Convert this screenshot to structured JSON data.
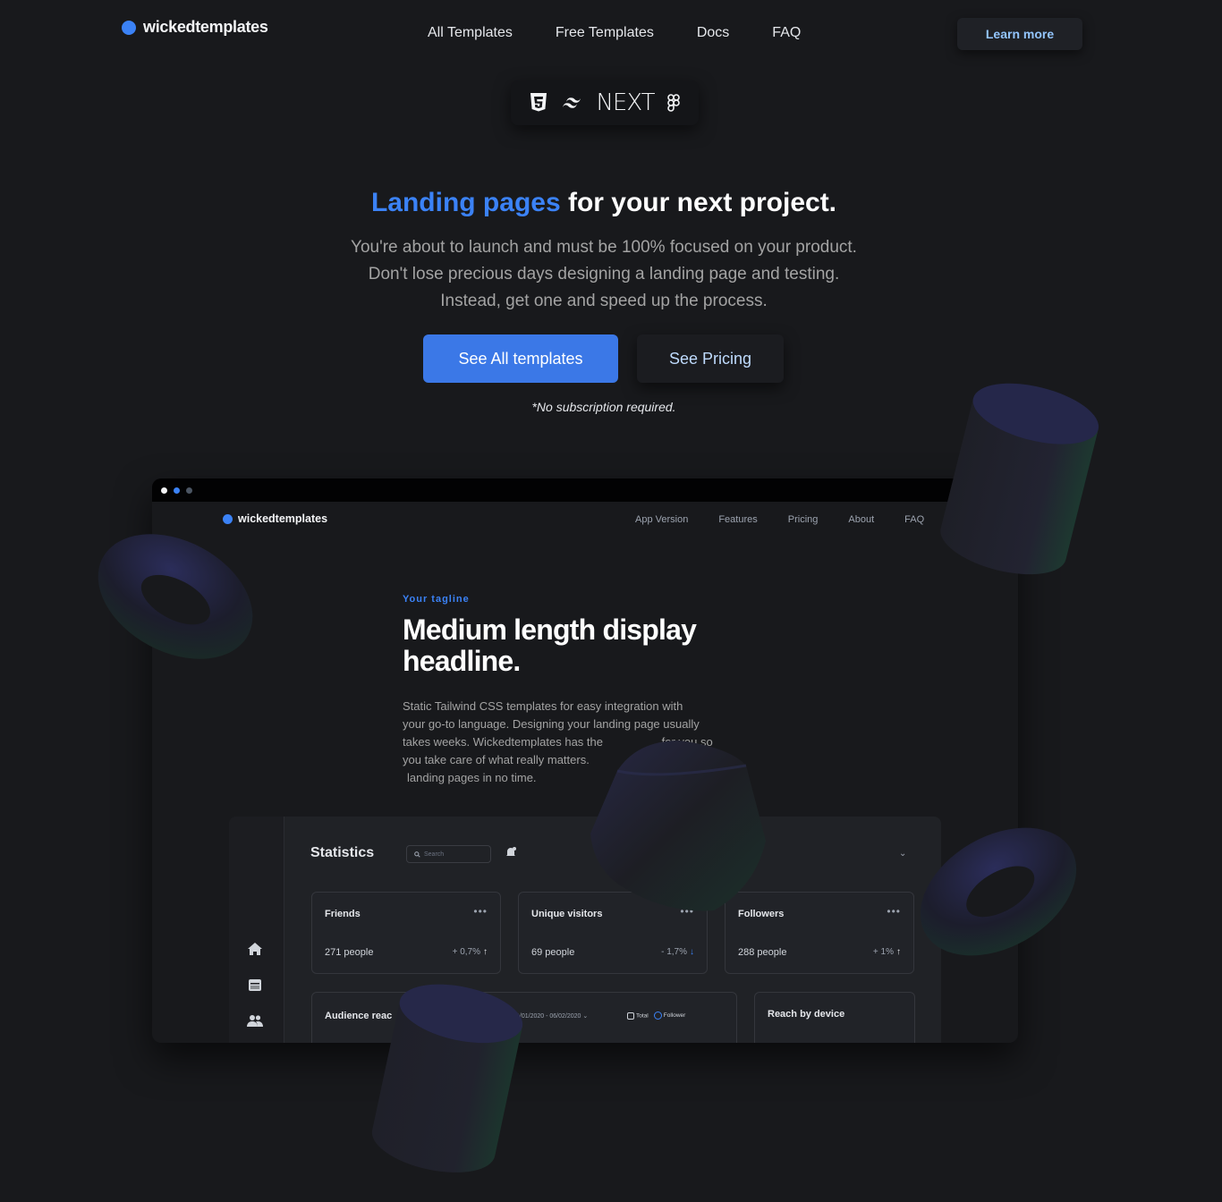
{
  "brand": {
    "name": "wickedtemplates",
    "accent": "#3b82f6"
  },
  "nav": {
    "links": [
      "All Templates",
      "Free Templates",
      "Docs",
      "FAQ"
    ],
    "cta": "Learn more"
  },
  "tech": {
    "next_label": "NEXT"
  },
  "hero": {
    "title_accent": "Landing pages",
    "title_rest": " for your next project.",
    "desc_line1": "You're about to launch and must be 100% focused on your product.",
    "desc_line2": "Don't lose precious days designing a landing page and testing.",
    "desc_line3": "Instead, get one and speed up the process.",
    "primary_cta": "See All templates",
    "secondary_cta": "See Pricing",
    "note": "*No subscription required."
  },
  "preview": {
    "logo": "wickedtemplates",
    "nav": [
      "App Version",
      "Features",
      "Pricing",
      "About",
      "FAQ"
    ],
    "tagline": "Your tagline",
    "headline": "Medium length display headline.",
    "body_line1": "Static Tailwind CSS templates for easy integration with",
    "body_line2": "your go-to language. Designing your landing page usually",
    "body_line3": "takes weeks. Wickedtemplates has the",
    "body_line3b": "for you so",
    "body_line4": "you take care of what really matters.",
    "body_line5": "landing pages in no time.",
    "dashboard": {
      "title": "Statistics",
      "search_placeholder": "Search",
      "cards": [
        {
          "title": "Friends",
          "value": "271 people",
          "delta": "+ 0,7%",
          "direction": "up"
        },
        {
          "title": "Unique visitors",
          "value": "69 people",
          "delta": "- 1,7%",
          "direction": "down"
        },
        {
          "title": "Followers",
          "value": "288 people",
          "delta": "+ 1%",
          "direction": "up"
        }
      ],
      "audience_title": "Audience reac",
      "audience_range": "1/01/2020 - 06/02/2020",
      "legend_total": "Total",
      "legend_follower": "Follower",
      "reach_title": "Reach by device"
    }
  }
}
